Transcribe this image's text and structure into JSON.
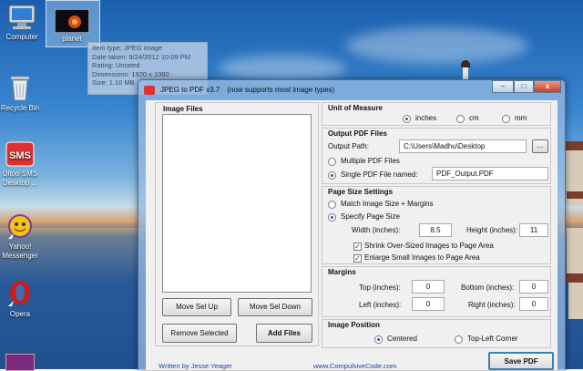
{
  "desktop": {
    "icons": {
      "computer": "Computer",
      "planet": "planet",
      "recycle_bin": "Recycle Bin",
      "sms": "Ultoo SMS Desktop ...",
      "yahoo": "Yahoo! Messenger",
      "opera": "Opera"
    },
    "tooltip": {
      "item_type": "Item type: JPEG image",
      "date_taken": "Date taken: 9/24/2012 10:09 PM",
      "rating": "Rating: Unrated",
      "dimensions": "Dimensions: 1920 x 1080",
      "size": "Size: 1.10 MB"
    }
  },
  "window": {
    "title": "JPEG to PDF  v3.7",
    "subtitle": "(now supports most image types)",
    "min_glyph": "–",
    "max_glyph": "□",
    "close_glyph": "x"
  },
  "image_files": {
    "heading": "Image Files",
    "move_up": "Move Sel Up",
    "move_down": "Move Sel Down",
    "remove": "Remove Selected",
    "add": "Add Files"
  },
  "unit": {
    "heading": "Unit of Measure",
    "options": [
      "inches",
      "cm",
      "mm"
    ],
    "selected": "inches"
  },
  "output": {
    "heading": "Output PDF Files",
    "path_label": "Output Path:",
    "path_value": "C:\\Users\\Madhu\\Desktop",
    "browse": "...",
    "multiple": "Multiple PDF Files",
    "single": "Single PDF File named:",
    "single_selected": true,
    "file_name": "PDF_Output.PDF"
  },
  "page_size": {
    "heading": "Page Size Settings",
    "match": "Match Image Size + Margins",
    "specify": "Specify Page Size",
    "width_label": "Width (inches):",
    "width_value": "8.5",
    "height_label": "Height (inches):",
    "height_value": "11",
    "shrink": "Shrink Over-Sized Images to Page Area",
    "enlarge": "Enlarge Small Images to Page Area",
    "check_glyph": "✓"
  },
  "margins": {
    "heading": "Margins",
    "top_label": "Top (inches):",
    "top_value": "0",
    "bottom_label": "Bottom (inches):",
    "bottom_value": "0",
    "left_label": "Left (inches):",
    "left_value": "0",
    "right_label": "Right (inches):",
    "right_value": "0"
  },
  "position": {
    "heading": "Image Position",
    "centered": "Centered",
    "top_left": "Top-Left Corner"
  },
  "footer": {
    "author": "Written by Jesse Yeager",
    "website": "www.CompulsiveCode.com",
    "save": "Save PDF"
  },
  "colors": {
    "accent": "#1a5fbf",
    "link": "#1a3faa",
    "sms_red": "#e03030",
    "opera_red": "#cc1b1b"
  }
}
